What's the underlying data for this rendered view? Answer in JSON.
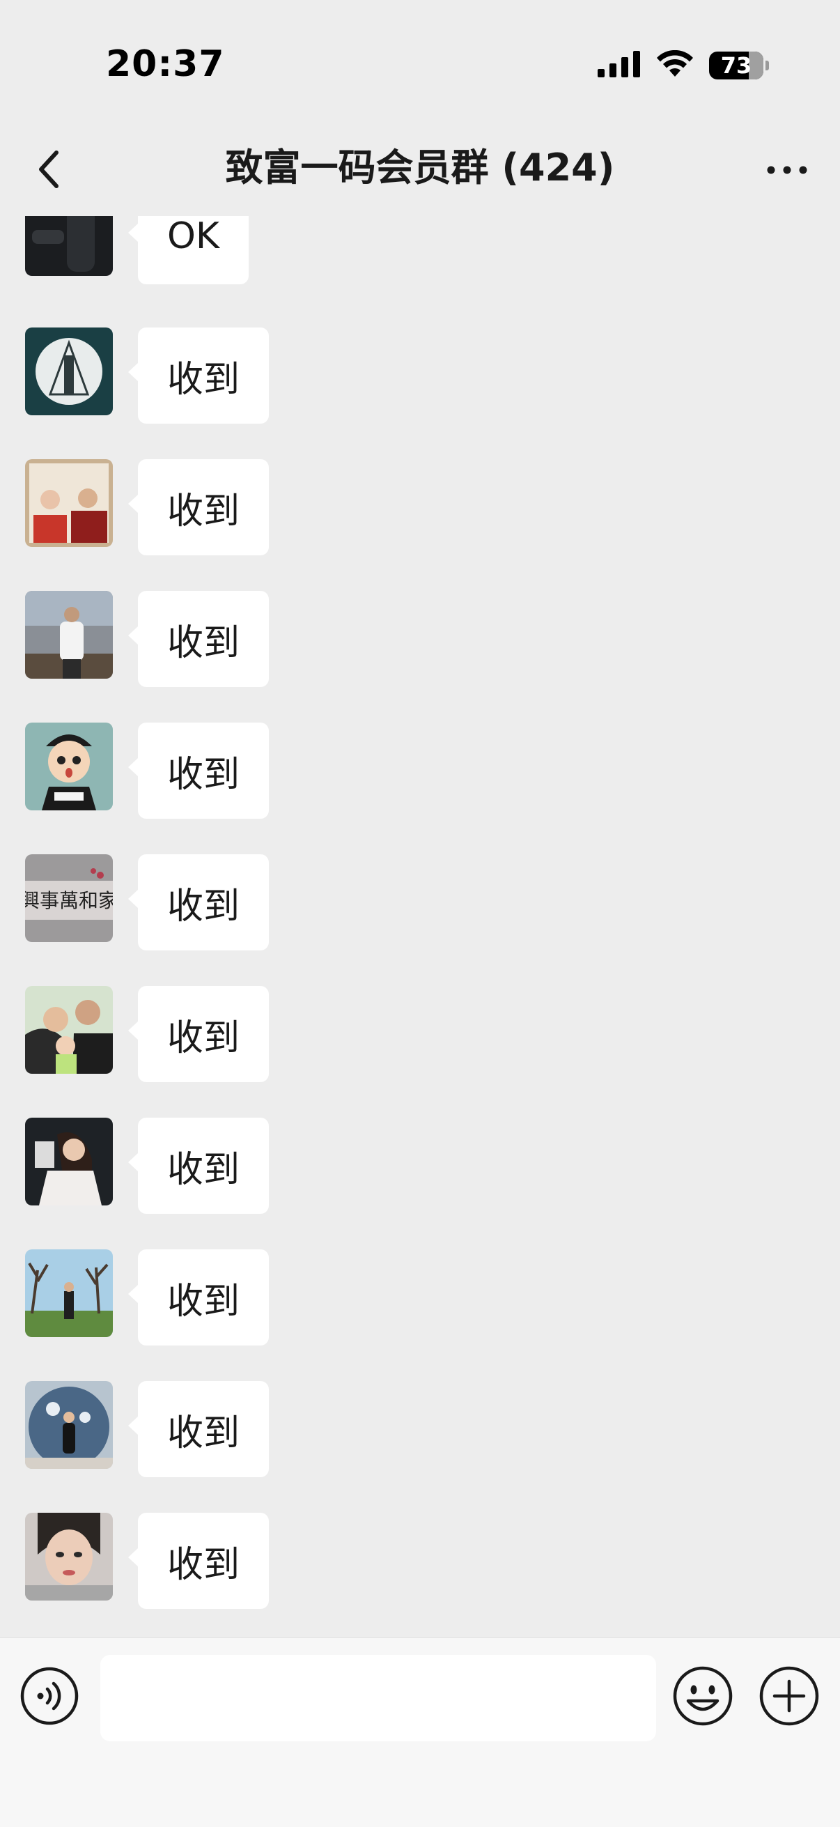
{
  "status_bar": {
    "time": "20:37",
    "battery_level": "73",
    "icons": [
      "signal-icon",
      "wifi-icon",
      "battery-icon"
    ]
  },
  "header": {
    "title": "致富一码会员群 (424)",
    "back_icon": "chevron-left-icon",
    "more_icon": "more-dots-icon"
  },
  "messages": [
    {
      "text": "OK"
    },
    {
      "text": "收到"
    },
    {
      "text": "收到"
    },
    {
      "text": "收到"
    },
    {
      "text": "收到"
    },
    {
      "text": "收到"
    },
    {
      "text": "收到"
    },
    {
      "text": "收到"
    },
    {
      "text": "收到"
    },
    {
      "text": "收到"
    },
    {
      "text": "收到"
    }
  ],
  "input_bar": {
    "placeholder": "",
    "voice_icon": "voice-icon",
    "emoji_icon": "emoji-icon",
    "plus_icon": "plus-icon"
  },
  "colors": {
    "background": "#ededed",
    "bubble": "#ffffff",
    "input_bar": "#f7f7f7"
  }
}
